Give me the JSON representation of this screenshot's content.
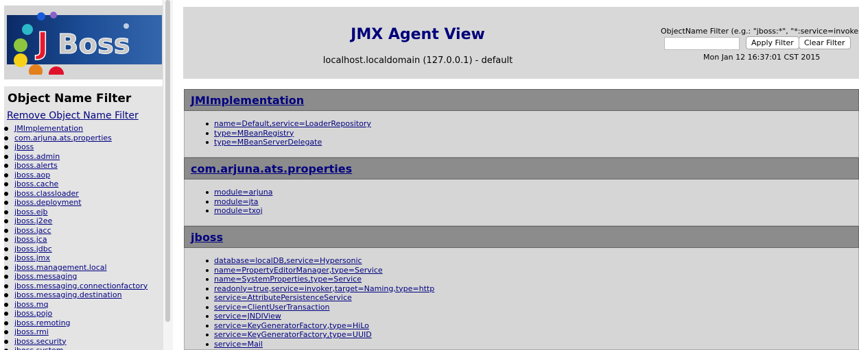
{
  "sidebar": {
    "logo_text": "JBoss",
    "filter_title": "Object Name Filter",
    "remove_filter_label": "Remove Object Name Filter",
    "domains": [
      "JMImplementation",
      "com.arjuna.ats.properties",
      "jboss",
      "jboss.admin",
      "jboss.alerts",
      "jboss.aop",
      "jboss.cache",
      "jboss.classloader",
      "jboss.deployment",
      "jboss.ejb",
      "jboss.j2ee",
      "jboss.jacc",
      "jboss.jca",
      "jboss.jdbc",
      "jboss.jmx",
      "jboss.management.local",
      "jboss.messaging",
      "jboss.messaging.connectionfactory",
      "jboss.messaging.destination",
      "jboss.mq",
      "jboss.pojo",
      "jboss.remoting",
      "jboss.rmi",
      "jboss.security",
      "jboss.system"
    ]
  },
  "header": {
    "title": "JMX Agent View",
    "host": "localhost.localdomain (127.0.0.1) - default",
    "filter_hint": "ObjectName Filter (e.g.: \"jboss:*\", \"*:service=invoker,*\"):",
    "filter_value": "",
    "apply_label": "Apply Filter",
    "clear_label": "Clear Filter",
    "date": "Mon Jan 12 16:37:01 CST 2015"
  },
  "sections": [
    {
      "domain": "JMImplementation",
      "mbeans": [
        "name=Default,service=LoaderRepository",
        "type=MBeanRegistry",
        "type=MBeanServerDelegate"
      ]
    },
    {
      "domain": "com.arjuna.ats.properties",
      "mbeans": [
        "module=arjuna",
        "module=jta",
        "module=txoj"
      ]
    },
    {
      "domain": "jboss",
      "mbeans": [
        "database=localDB,service=Hypersonic",
        "name=PropertyEditorManager,type=Service",
        "name=SystemProperties,type=Service",
        "readonly=true,service=invoker,target=Naming,type=http",
        "service=AttributePersistenceService",
        "service=ClientUserTransaction",
        "service=JNDIView",
        "service=KeyGeneratorFactory,type=HiLo",
        "service=KeyGeneratorFactory,type=UUID",
        "service=Mail"
      ]
    }
  ]
}
